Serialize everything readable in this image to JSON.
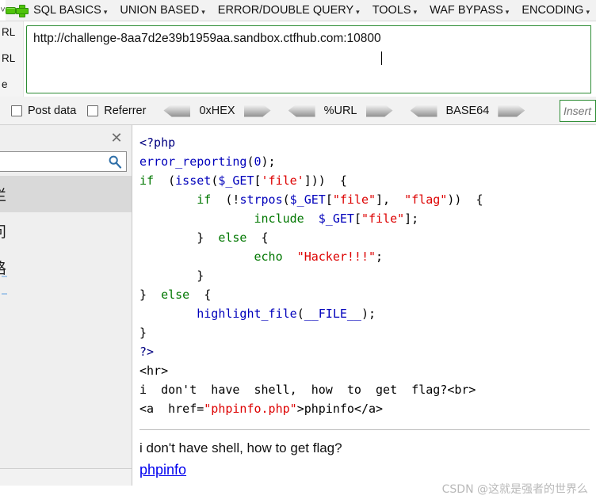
{
  "menubar": {
    "chevron_icon": "chevron-down-icon",
    "minus_icon": "green-minus-icon",
    "plus_icon": "green-plus-icon",
    "items": [
      {
        "label": "SQL BASICS",
        "caret": "▾"
      },
      {
        "label": "UNION BASED",
        "caret": "▾"
      },
      {
        "label": "ERROR/DOUBLE QUERY",
        "caret": "▾"
      },
      {
        "label": "TOOLS",
        "caret": "▾"
      },
      {
        "label": "WAF BYPASS",
        "caret": "▾"
      },
      {
        "label": "ENCODING",
        "caret": "▾"
      }
    ]
  },
  "urlrow": {
    "side_labels": [
      "RL",
      "RL",
      "e"
    ],
    "url_value": "http://challenge-8aa7d2e39b1959aa.sandbox.ctfhub.com:10800",
    "url_placeholder": "URL"
  },
  "options": {
    "post_data_label": "Post data",
    "referrer_label": "Referrer",
    "encoders": [
      "0xHEX",
      "%URL",
      "BASE64"
    ],
    "insert_value": "",
    "insert_placeholder": "Insert"
  },
  "sidepanel": {
    "close_icon": "close-icon",
    "search_icon": "search-icon",
    "search_value": "",
    "search_placeholder": "",
    "items": [
      {
        "label": "栏",
        "selected": true
      },
      {
        "label": "问",
        "selected": false
      },
      {
        "label": "路",
        "selected": false
      }
    ]
  },
  "code": {
    "lines": [
      [
        {
          "t": "<?php",
          "c": "t-tag"
        }
      ],
      [
        {
          "t": "error_reporting",
          "c": "t-fn"
        },
        {
          "t": "(",
          "c": "t-blk"
        },
        {
          "t": "0",
          "c": "t-fn"
        },
        {
          "t": ");",
          "c": "t-blk"
        }
      ],
      [
        {
          "t": "if",
          "c": "t-kw"
        },
        {
          "t": "  (",
          "c": "t-blk"
        },
        {
          "t": "isset",
          "c": "t-fn"
        },
        {
          "t": "(",
          "c": "t-blk"
        },
        {
          "t": "$_GET",
          "c": "t-var"
        },
        {
          "t": "[",
          "c": "t-blk"
        },
        {
          "t": "'file'",
          "c": "t-str"
        },
        {
          "t": "]))  {",
          "c": "t-blk"
        }
      ],
      [
        {
          "t": "        ",
          "c": "t-blk"
        },
        {
          "t": "if",
          "c": "t-kw"
        },
        {
          "t": "  (!",
          "c": "t-blk"
        },
        {
          "t": "strpos",
          "c": "t-fn"
        },
        {
          "t": "(",
          "c": "t-blk"
        },
        {
          "t": "$_GET",
          "c": "t-var"
        },
        {
          "t": "[",
          "c": "t-blk"
        },
        {
          "t": "\"file\"",
          "c": "t-str"
        },
        {
          "t": "],  ",
          "c": "t-blk"
        },
        {
          "t": "\"flag\"",
          "c": "t-str"
        },
        {
          "t": "))  {",
          "c": "t-blk"
        }
      ],
      [
        {
          "t": "                ",
          "c": "t-blk"
        },
        {
          "t": "include",
          "c": "t-kw"
        },
        {
          "t": "  ",
          "c": "t-blk"
        },
        {
          "t": "$_GET",
          "c": "t-var"
        },
        {
          "t": "[",
          "c": "t-blk"
        },
        {
          "t": "\"file\"",
          "c": "t-str"
        },
        {
          "t": "];",
          "c": "t-blk"
        }
      ],
      [
        {
          "t": "        }  ",
          "c": "t-blk"
        },
        {
          "t": "else",
          "c": "t-kw"
        },
        {
          "t": "  {",
          "c": "t-blk"
        }
      ],
      [
        {
          "t": "                ",
          "c": "t-blk"
        },
        {
          "t": "echo",
          "c": "t-kw"
        },
        {
          "t": "  ",
          "c": "t-blk"
        },
        {
          "t": "\"Hacker!!!\"",
          "c": "t-str"
        },
        {
          "t": ";",
          "c": "t-blk"
        }
      ],
      [
        {
          "t": "        }",
          "c": "t-blk"
        }
      ],
      [
        {
          "t": "}  ",
          "c": "t-blk"
        },
        {
          "t": "else",
          "c": "t-kw"
        },
        {
          "t": "  {",
          "c": "t-blk"
        }
      ],
      [
        {
          "t": "        ",
          "c": "t-blk"
        },
        {
          "t": "highlight_file",
          "c": "t-fn"
        },
        {
          "t": "(",
          "c": "t-blk"
        },
        {
          "t": "__FILE__",
          "c": "t-var"
        },
        {
          "t": ");",
          "c": "t-blk"
        }
      ],
      [
        {
          "t": "}",
          "c": "t-blk"
        }
      ],
      [
        {
          "t": "?>",
          "c": "t-tag"
        }
      ],
      [
        {
          "t": "<hr>",
          "c": "t-blk"
        }
      ],
      [
        {
          "t": "i  don't  have  shell,  how  to  get  flag?<br>",
          "c": "t-blk"
        }
      ],
      [
        {
          "t": "<a  href=",
          "c": "t-blk"
        },
        {
          "t": "\"phpinfo.php\"",
          "c": "t-str"
        },
        {
          "t": ">phpinfo</a>",
          "c": "t-blk"
        }
      ]
    ]
  },
  "output": {
    "text": "i don't have shell, how to get flag?",
    "link_label": "phpinfo"
  },
  "watermark": {
    "text": "CSDN @这就是强者的世界么"
  },
  "colors": {
    "accent_green": "#2c8c33",
    "icon_green": "#4fc30a",
    "link_blue": "#0000ee",
    "string_red": "#dd0000",
    "keyword_green": "#007700",
    "function_blue": "#0000bb"
  }
}
